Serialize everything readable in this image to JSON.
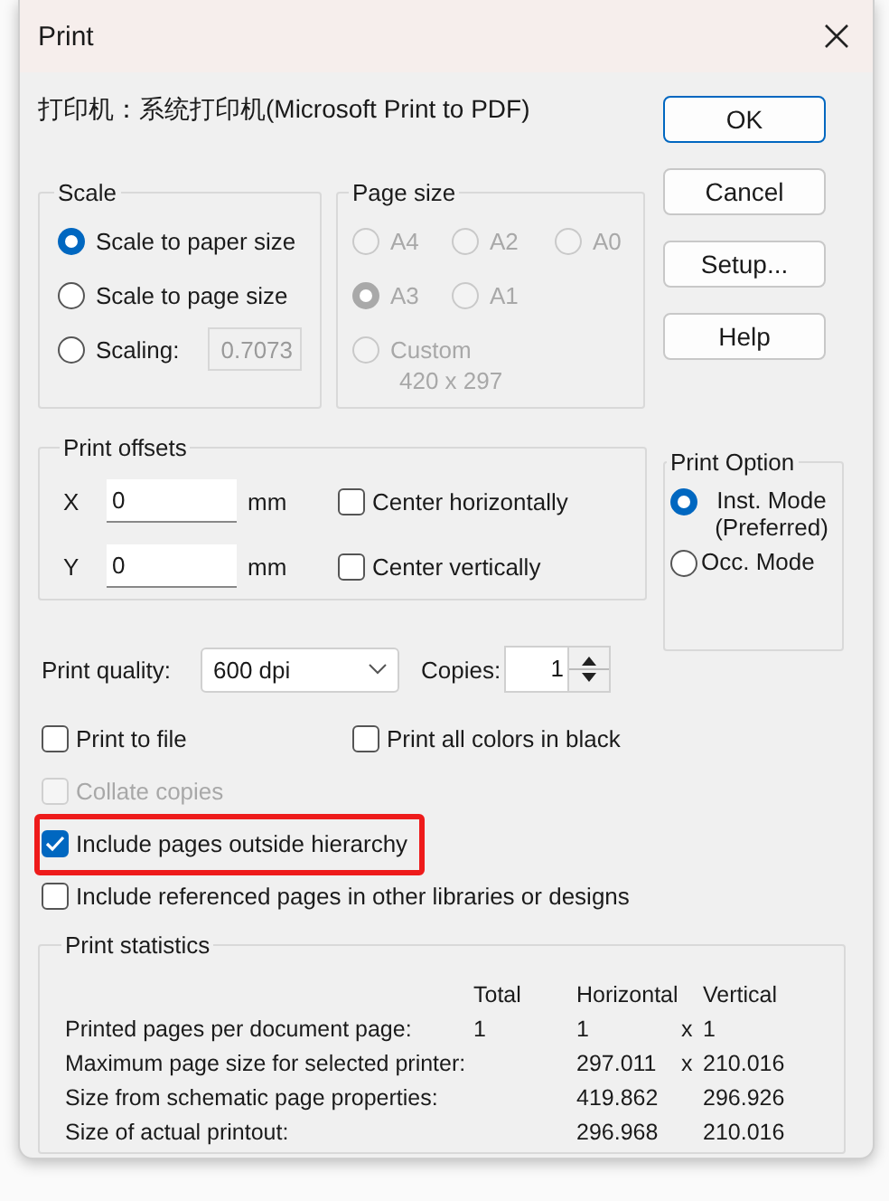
{
  "window": {
    "title": "Print"
  },
  "printer": "打印机：系统打印机(Microsoft Print to PDF)",
  "buttons": [
    {
      "label": "OK",
      "default": true
    },
    {
      "label": "Cancel",
      "default": false
    },
    {
      "label": "Setup...",
      "default": false
    },
    {
      "label": "Help",
      "default": false
    }
  ],
  "scale": {
    "title": "Scale",
    "options": [
      {
        "kind": "radio",
        "label": "Scale to paper size",
        "selected": true
      },
      {
        "kind": "radio",
        "label": "Scale to page size",
        "selected": false
      },
      {
        "kind": "radio_field",
        "label": "Scaling:",
        "selected": false,
        "value": "0.7073",
        "disabled": true
      }
    ]
  },
  "page_size": {
    "title": "Page size",
    "options": [
      {
        "kind": "radio",
        "label": "A4",
        "selected": false,
        "disabled": true
      },
      {
        "kind": "radio",
        "label": "A2",
        "selected": false,
        "disabled": true
      },
      {
        "kind": "radio",
        "label": "A0",
        "selected": false,
        "disabled": true
      },
      {
        "kind": "radio",
        "label": "A3",
        "selected": true,
        "disabled": true
      },
      {
        "kind": "radio",
        "label": "A1",
        "selected": false,
        "disabled": true
      },
      {
        "kind": "custom",
        "label": "Custom",
        "selected": false,
        "disabled": true
      }
    ],
    "custom_size": "420 x 297"
  },
  "offsets": {
    "title": "Print offsets",
    "fields": [
      {
        "label": "X",
        "value": "0",
        "unit": "mm"
      },
      {
        "label": "Y",
        "value": "0",
        "unit": "mm"
      }
    ],
    "checkboxes": [
      {
        "label": "Center horizontally",
        "checked": false
      },
      {
        "label": "Center vertically",
        "checked": false
      }
    ]
  },
  "print_option": {
    "title": "Print Option",
    "options": [
      {
        "label": "Inst. Mode (Preferred)",
        "selected": true
      },
      {
        "label": "Occ. Mode",
        "selected": false
      }
    ]
  },
  "quality": {
    "label": "Print quality:",
    "value": "600 dpi"
  },
  "copies": {
    "label": "Copies:",
    "value": "1"
  },
  "options": [
    [
      {
        "label": "Print to file",
        "checked": false,
        "disabled": false,
        "highlighted": false
      },
      {
        "label": "Print all colors in black",
        "checked": false,
        "disabled": false,
        "highlighted": false
      }
    ],
    [
      {
        "label": "Collate copies",
        "checked": false,
        "disabled": true,
        "highlighted": false
      }
    ],
    [
      {
        "label": "Include pages outside hierarchy",
        "checked": true,
        "disabled": false,
        "highlighted": true
      }
    ],
    [
      {
        "label": "Include referenced pages in other libraries or designs",
        "checked": false,
        "disabled": false,
        "highlighted": false
      }
    ]
  ],
  "statistics": {
    "title": "Print statistics",
    "columns": [
      "Total",
      "Horizontal",
      "Vertical"
    ],
    "rows": [
      {
        "label": "Printed pages per document page:",
        "total": "1",
        "horizontal": "1",
        "separator": "x",
        "vertical": "1"
      },
      {
        "label": "Maximum page size for selected printer:",
        "horizontal": "297.011",
        "separator": "x",
        "vertical": "210.016"
      },
      {
        "label": "Size from schematic page properties:",
        "horizontal": "419.862",
        "vertical": "296.926"
      },
      {
        "label": "Size of actual printout:",
        "horizontal": "296.968",
        "vertical": "210.016"
      }
    ]
  }
}
